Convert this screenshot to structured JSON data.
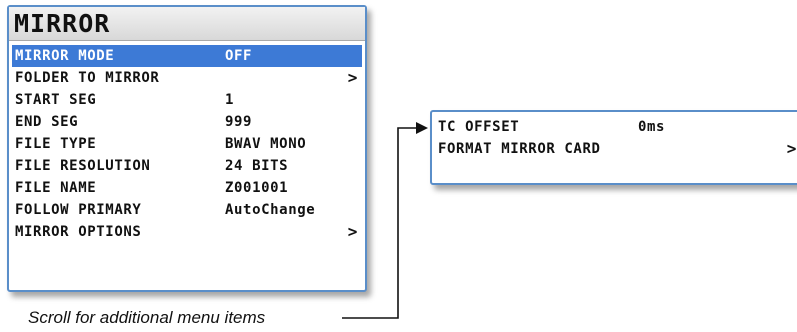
{
  "main_menu": {
    "title": "MIRROR",
    "items": [
      {
        "label": "MIRROR MODE",
        "value": "OFF",
        "selected": true
      },
      {
        "label": "FOLDER TO MIRROR",
        "value": "",
        "submenu": true
      },
      {
        "label": "START SEG",
        "value": "1"
      },
      {
        "label": "END SEG",
        "value": "999"
      },
      {
        "label": "FILE TYPE",
        "value": "BWAV MONO"
      },
      {
        "label": "FILE RESOLUTION",
        "value": "24 BITS"
      },
      {
        "label": "FILE NAME",
        "value": "Z001001"
      },
      {
        "label": "FOLLOW PRIMARY",
        "value": "AutoChange"
      },
      {
        "label": "MIRROR OPTIONS",
        "value": "",
        "submenu": true
      }
    ]
  },
  "more_menu": {
    "items": [
      {
        "label": "TC OFFSET",
        "value": "0ms"
      },
      {
        "label": "FORMAT MIRROR CARD",
        "value": "",
        "submenu": true
      }
    ]
  },
  "chevron": ">",
  "caption": "Scroll for additional menu items",
  "colors": {
    "highlight": "#3d7ad6",
    "border": "#5a8ec9",
    "text": "#111111"
  }
}
